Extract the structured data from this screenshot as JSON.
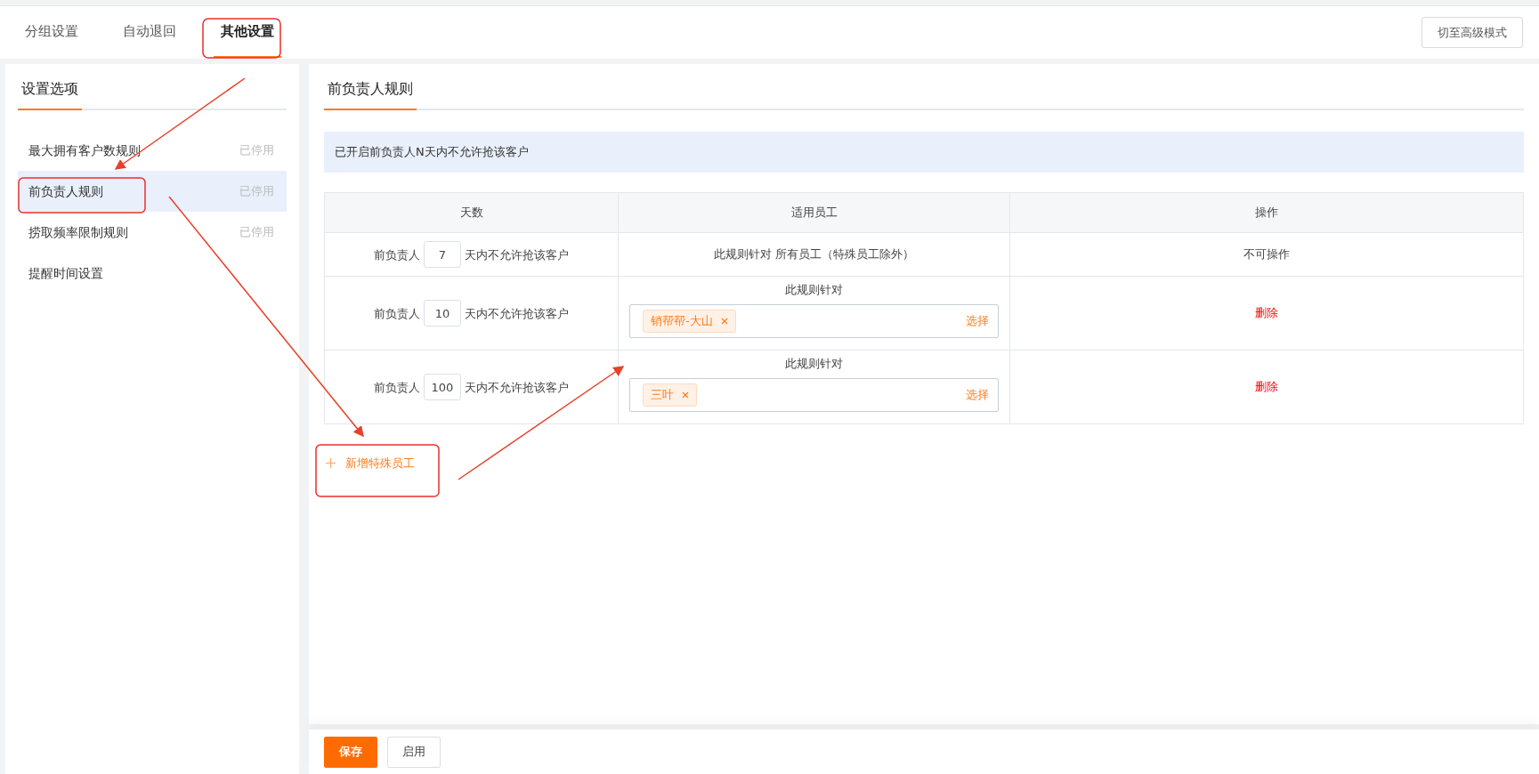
{
  "tabs": [
    {
      "label": "分组设置",
      "selected": false
    },
    {
      "label": "自动退回",
      "selected": false
    },
    {
      "label": "其他设置",
      "selected": true
    }
  ],
  "advanced_button": "切至高级模式",
  "sidebar": {
    "title": "设置选项",
    "items": [
      {
        "label": "最大拥有客户数规则",
        "status": "已停用",
        "selected": false
      },
      {
        "label": "前负责人规则",
        "status": "已停用",
        "selected": true
      },
      {
        "label": "捞取频率限制规则",
        "status": "已停用",
        "selected": false
      },
      {
        "label": "提醒时间设置",
        "selected": false
      }
    ]
  },
  "panel": {
    "title": "前负责人规则",
    "notice": "已开启前负责人N天内不允许抢该客户",
    "table": {
      "columns": [
        "天数",
        "适用员工",
        "操作"
      ],
      "rows": [
        {
          "kind": "fixed",
          "prefix": "前负责人",
          "days": "7",
          "suffix": "天内不允许抢该客户",
          "employees": "此规则针对 所有员工（特殊员工除外）",
          "action": "不可操作"
        },
        {
          "kind": "special",
          "prefix": "前负责人",
          "days": "10",
          "suffix": "天内不允许抢该客户",
          "employees": "此规则针对",
          "tags": [
            "销帮帮-大山"
          ],
          "select": "选择",
          "action": "删除"
        },
        {
          "kind": "special",
          "prefix": "前负责人",
          "days": "100",
          "suffix": "天内不允许抢该客户",
          "employees": "此规则针对",
          "tags": [
            "三叶"
          ],
          "select": "选择",
          "action": "删除"
        }
      ]
    },
    "add_link": "新增特殊员工"
  },
  "footer_buttons": [
    {
      "label": "保存",
      "kind": "primary"
    },
    {
      "label": "启用",
      "kind": "default"
    }
  ]
}
